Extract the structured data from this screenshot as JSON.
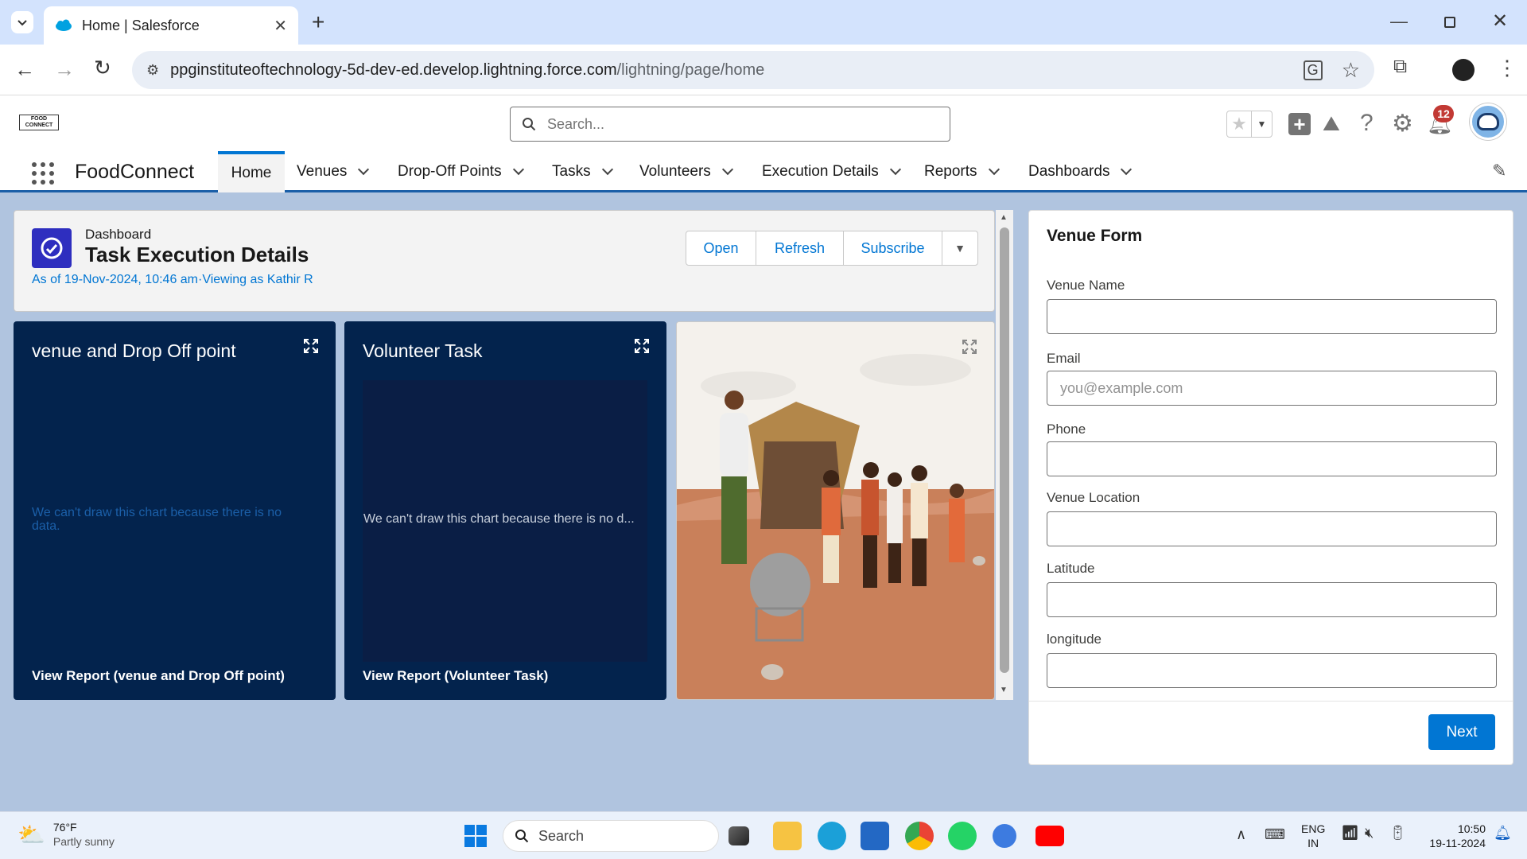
{
  "browser": {
    "tab_title": "Home | Salesforce",
    "url_domain": "ppginstituteoftechnology-5d-dev-ed.develop.lightning.force.com",
    "url_path": "/lightning/page/home"
  },
  "header": {
    "logo_text": "FOOD CONNECT",
    "search_placeholder": "Search...",
    "notification_count": "12"
  },
  "nav": {
    "app_name": "FoodConnect",
    "items": [
      {
        "label": "Home"
      },
      {
        "label": "Venues"
      },
      {
        "label": "Drop-Off Points"
      },
      {
        "label": "Tasks"
      },
      {
        "label": "Volunteers"
      },
      {
        "label": "Execution Details"
      },
      {
        "label": "Reports"
      },
      {
        "label": "Dashboards"
      }
    ]
  },
  "dashboard": {
    "eyebrow": "Dashboard",
    "title": "Task Execution Details",
    "subtitle": "As of 19-Nov-2024, 10:46 am·Viewing as Kathir R",
    "buttons": {
      "open": "Open",
      "refresh": "Refresh",
      "subscribe": "Subscribe"
    },
    "cards": [
      {
        "title": "venue and Drop Off point",
        "message": "We can't draw this chart because there is no data.",
        "link": "View Report (venue and Drop Off point)"
      },
      {
        "title": "Volunteer Task",
        "message": "We can't draw this chart because there is no d...",
        "link": "View Report (Volunteer Task)"
      }
    ]
  },
  "form": {
    "title": "Venue Form",
    "fields": [
      {
        "label": "Venue Name",
        "value": ""
      },
      {
        "label": "Email",
        "placeholder": "you@example.com"
      },
      {
        "label": "Phone",
        "value": ""
      },
      {
        "label": "Venue Location",
        "value": ""
      },
      {
        "label": "Latitude",
        "value": ""
      },
      {
        "label": "longitude",
        "value": ""
      }
    ],
    "next_label": "Next"
  },
  "taskbar": {
    "temp": "76°F",
    "weather": "Partly sunny",
    "search_label": "Search",
    "lang_top": "ENG",
    "lang_bottom": "IN",
    "time": "10:50",
    "date": "19-11-2024"
  },
  "colors": {
    "brand_blue": "#0176d3",
    "card_bg": "#03234d",
    "nav_accent": "#1b5fa8"
  }
}
